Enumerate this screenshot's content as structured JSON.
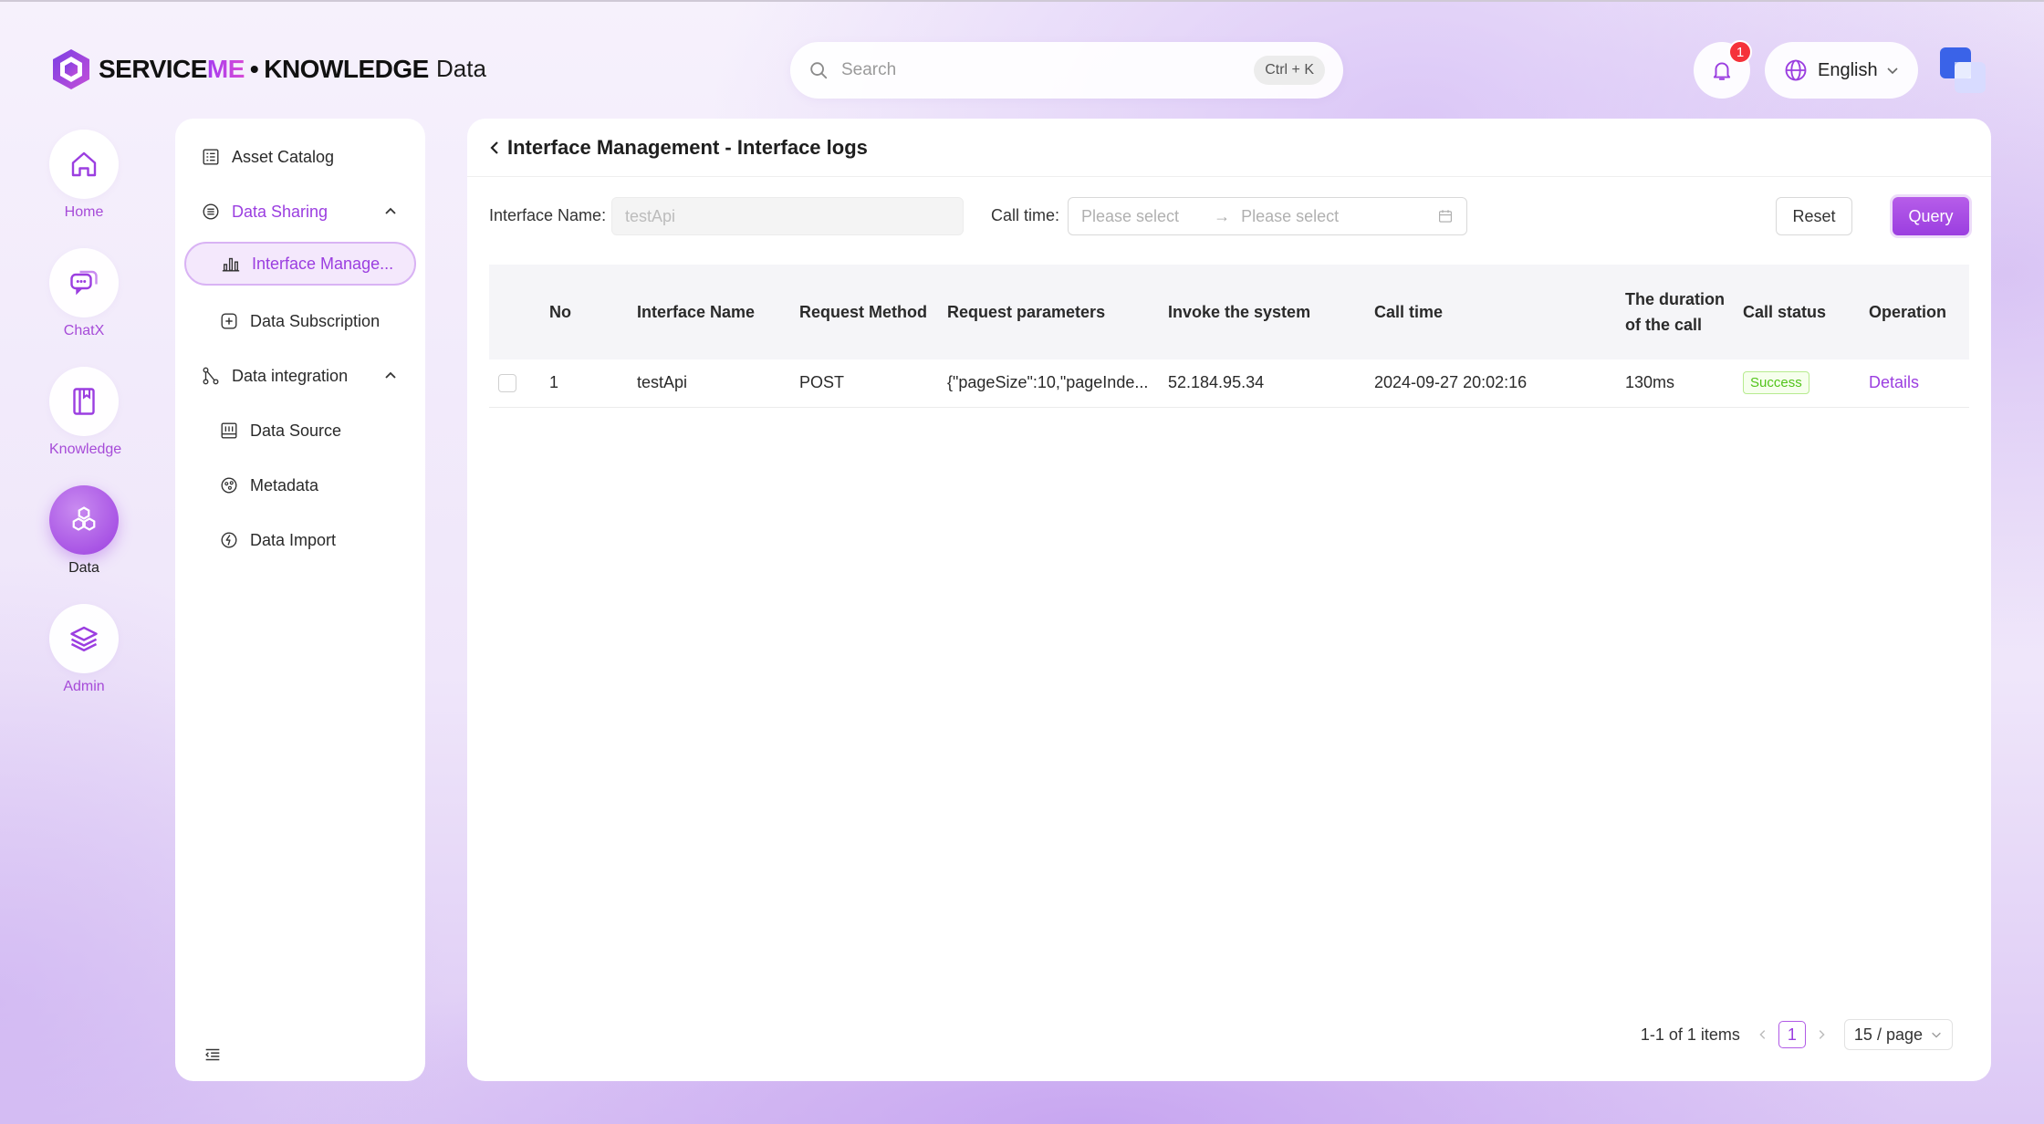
{
  "header": {
    "brand_left": "SERVICE",
    "brand_me": "ME",
    "brand_dot": "•",
    "brand_right": "KNOWLEDGE",
    "section_title": "Data",
    "search_placeholder": "Search",
    "search_shortcut": "Ctrl + K",
    "notification_count": "1",
    "language": "English"
  },
  "rail": {
    "items": [
      {
        "label": "Home",
        "icon": "home-icon"
      },
      {
        "label": "ChatX",
        "icon": "chat-icon"
      },
      {
        "label": "Knowledge",
        "icon": "book-icon"
      },
      {
        "label": "Data",
        "icon": "hexagons-icon",
        "active": true
      },
      {
        "label": "Admin",
        "icon": "layers-icon"
      }
    ]
  },
  "subnav": {
    "asset_catalog": "Asset Catalog",
    "data_sharing": "Data Sharing",
    "interface_management": "Interface Manage...",
    "data_subscription": "Data Subscription",
    "data_integration": "Data integration",
    "data_source": "Data Source",
    "metadata": "Metadata",
    "data_import": "Data Import"
  },
  "page": {
    "title": "Interface Management - Interface logs"
  },
  "filters": {
    "interface_name_label": "Interface Name",
    "interface_name_value": "testApi",
    "call_time_label": "Call time",
    "start_placeholder": "Please select",
    "end_placeholder": "Please select",
    "reset_label": "Reset",
    "query_label": "Query"
  },
  "table": {
    "columns": [
      "No",
      "Interface Name",
      "Request Method",
      "Request parameters",
      "Invoke the system",
      "Call time",
      "The duration of the call",
      "Call status",
      "Operation"
    ],
    "rows": [
      {
        "no": "1",
        "interface_name": "testApi",
        "method": "POST",
        "params": "{\"pageSize\":10,\"pageInde...",
        "system": "52.184.95.34",
        "call_time": "2024-09-27 20:02:16",
        "duration": "130ms",
        "status": "Success",
        "operation": "Details"
      }
    ]
  },
  "pagination": {
    "total": "1-1 of 1 items",
    "current_page": "1",
    "page_size": "15 / page"
  },
  "colors": {
    "accent": "#9b3ee0",
    "success": "#52c41a",
    "badge": "#f5323a"
  }
}
